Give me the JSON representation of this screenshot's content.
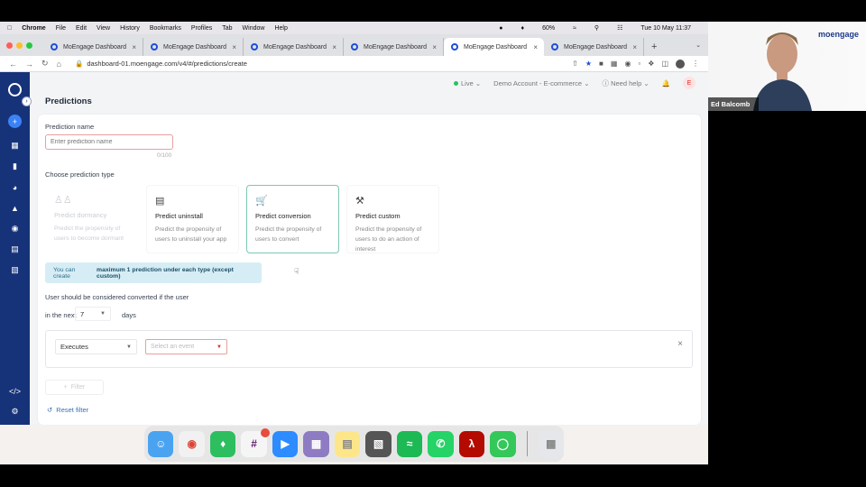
{
  "menubar": {
    "app": "Chrome",
    "items": [
      "File",
      "Edit",
      "View",
      "History",
      "Bookmarks",
      "Profiles",
      "Tab",
      "Window",
      "Help"
    ],
    "battery": "60%",
    "clock": "Tue 10 May  11:37"
  },
  "browser": {
    "tabs": [
      {
        "title": "MoEngage Dashboard"
      },
      {
        "title": "MoEngage Dashboard"
      },
      {
        "title": "MoEngage Dashboard"
      },
      {
        "title": "MoEngage Dashboard"
      },
      {
        "title": "MoEngage Dashboard"
      },
      {
        "title": "MoEngage Dashboard"
      }
    ],
    "url": "dashboard-01.moengage.com/v4/#/predictions/create"
  },
  "topbar": {
    "status": "Live",
    "account": "Demo Account - E-commerce",
    "help": "Need help",
    "user_initial": "E"
  },
  "page": {
    "title": "Predictions",
    "name_label": "Prediction name",
    "name_placeholder": "Enter prediction name",
    "counter": "0/100",
    "type_label": "Choose prediction type",
    "types": [
      {
        "title": "Predict dormancy",
        "desc": "Predict the propensity of users to become dormant"
      },
      {
        "title": "Predict uninstall",
        "desc": "Predict the propensity of users to uninstall your app"
      },
      {
        "title": "Predict conversion",
        "desc": "Predict the propensity of users to convert"
      },
      {
        "title": "Predict custom",
        "desc": "Predict the propensity of users to do an action of interest"
      }
    ],
    "info_pre": "You can create",
    "info_bold": "maximum 1 prediction under each type (except custom)",
    "converted_label": "User should be considered converted if the user",
    "in_next": "in the next",
    "days_value": "7",
    "days_unit": "days",
    "executes": "Executes",
    "event_placeholder": "Select an event",
    "filter": "Filter",
    "reset_filter": "Reset filter"
  },
  "webcam": {
    "brand": "moengage",
    "name": "Ed Balcomb"
  },
  "colors": {
    "sidebar": "#16337a",
    "accent": "#3b82f6",
    "selected_border": "#7cc6b6",
    "info_bg": "#d6edf5"
  }
}
